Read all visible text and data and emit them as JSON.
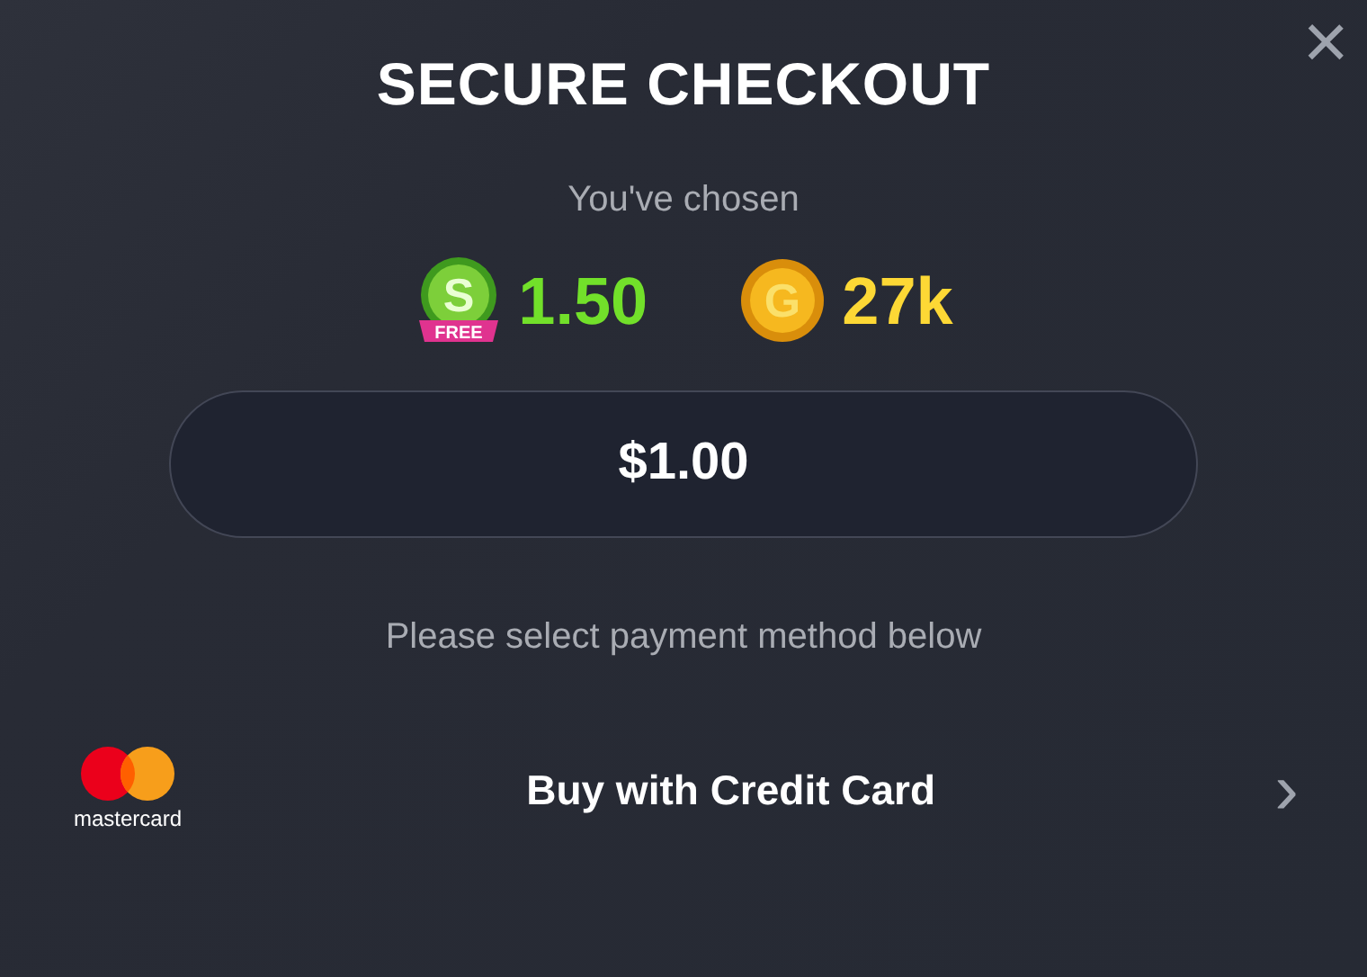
{
  "title": "SECURE CHECKOUT",
  "close": "×",
  "subtitle": "You've chosen",
  "currencies": [
    {
      "kind": "sweeps",
      "symbol": "S",
      "badge": "FREE",
      "amount": "1.50"
    },
    {
      "kind": "coins",
      "symbol": "G",
      "amount": "27k"
    }
  ],
  "price": "$1.00",
  "instruction": "Please select payment method below",
  "payment": {
    "brand": "mastercard",
    "label": "Buy with Credit Card",
    "arrow": "›"
  }
}
